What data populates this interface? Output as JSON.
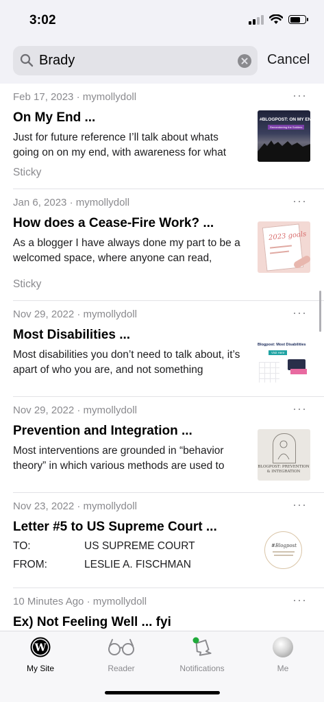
{
  "status_bar": {
    "time": "3:02"
  },
  "search": {
    "query": "Brady",
    "cancel_label": "Cancel"
  },
  "posts": [
    {
      "meta": "Feb 17, 2023 · mymollydoll",
      "title": "On My End ...",
      "excerpt": "Just for future reference I’ll talk about whats going on on my end, with awareness for what",
      "tag": "Sticky",
      "thumb_text": "#BLOGPOST: ON MY END",
      "thumb_subtext": "Remembering the Soldiers"
    },
    {
      "meta": "Jan 6, 2023 · mymollydoll",
      "title": "How does a Cease-Fire Work? ...",
      "excerpt": "As a blogger I have always done my part to be a welcomed space, where anyone can read,",
      "tag": "Sticky",
      "thumb_text": "2023 goals"
    },
    {
      "meta": "Nov 29, 2022 · mymollydoll",
      "title": "Most Disabilities ...",
      "excerpt": "Most disabilities you don’t need to talk about, it’s apart of who you are, and not something",
      "thumb_text": "Blogpost: Most Disabilities",
      "thumb_button": "Visit Here"
    },
    {
      "meta": "Nov 29, 2022 · mymollydoll",
      "title": "Prevention and Integration ...",
      "excerpt": "Most interventions are grounded in “behavior theory” in which various methods are used to",
      "thumb_text": "BLOGPOST: PREVENTION & INTEGRATION"
    },
    {
      "meta": "Nov 23, 2022 · mymollydoll",
      "title": "Letter #5 to US Supreme Court ...",
      "letter_lines": [
        {
          "label": "TO:",
          "value": "US SUPREME COURT"
        },
        {
          "label": "FROM:",
          "value": "LESLIE A. FISCHMAN"
        }
      ],
      "thumb_text": "#Blogpost"
    },
    {
      "meta": "10 Minutes Ago · mymollydoll",
      "title": "Ex) Not Feeling Well ... fyi"
    }
  ],
  "tabs": [
    {
      "label": "My Site",
      "icon": "wordpress-icon",
      "active": true
    },
    {
      "label": "Reader",
      "icon": "glasses-icon",
      "active": false
    },
    {
      "label": "Notifications",
      "icon": "bell-icon",
      "active": false,
      "badge_color": "#1faa3a"
    },
    {
      "label": "Me",
      "icon": "avatar",
      "active": false
    }
  ],
  "colors": {
    "accent": "#000000",
    "secondary_text": "#8a8a8e",
    "notification_dot": "#1faa3a"
  }
}
